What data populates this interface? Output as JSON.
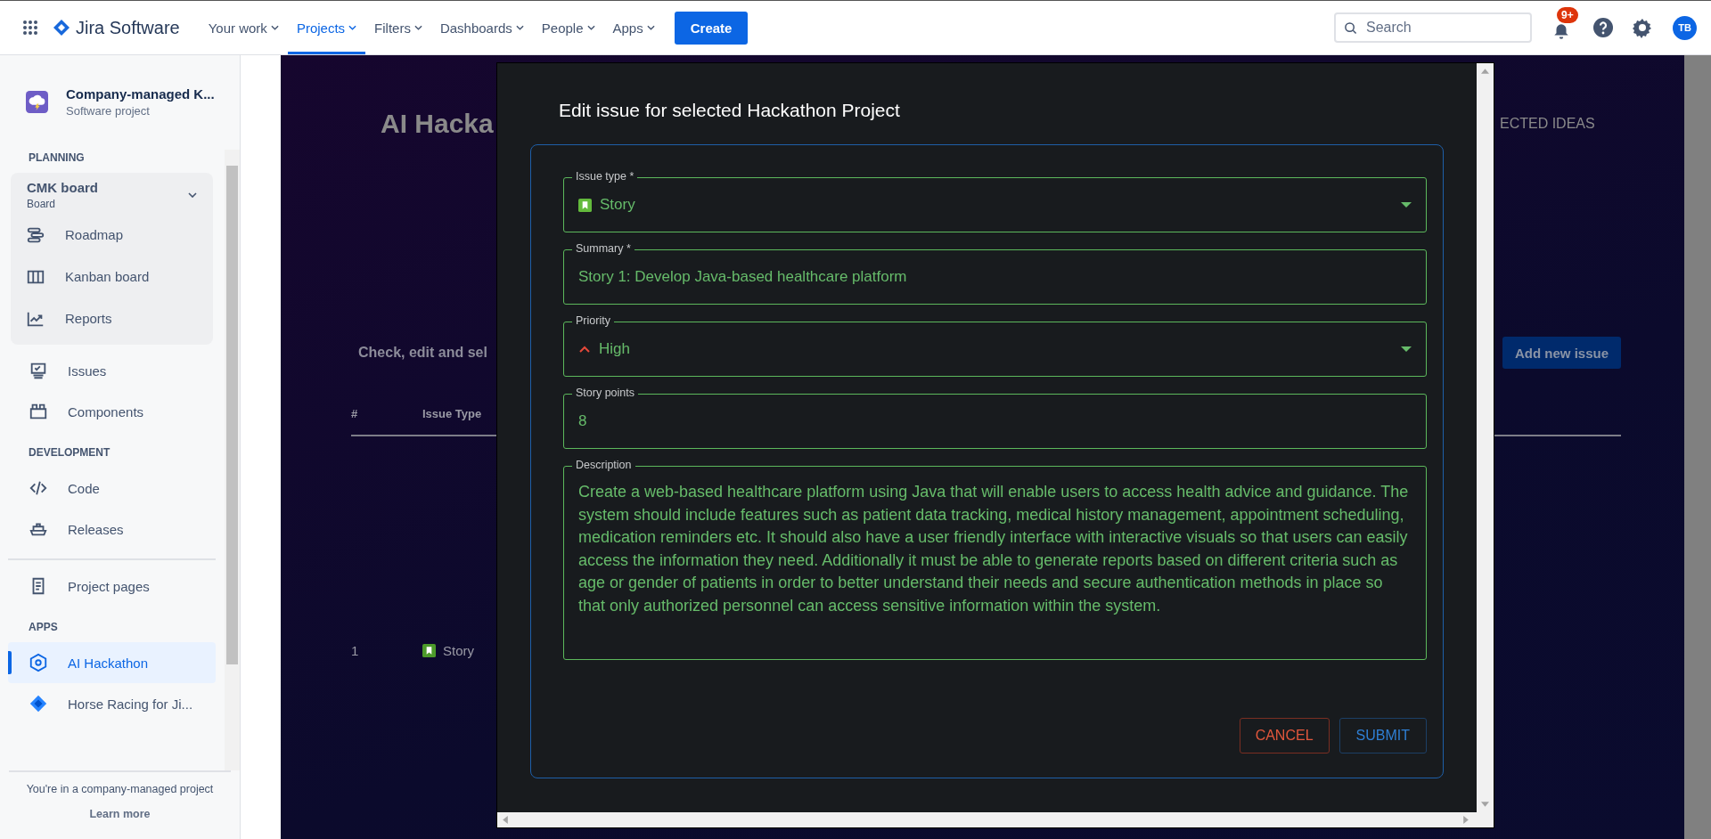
{
  "topbar": {
    "product": "Jira Software",
    "nav": [
      {
        "label": "Your work",
        "selected": false
      },
      {
        "label": "Projects",
        "selected": true
      },
      {
        "label": "Filters",
        "selected": false
      },
      {
        "label": "Dashboards",
        "selected": false
      },
      {
        "label": "People",
        "selected": false
      },
      {
        "label": "Apps",
        "selected": false
      }
    ],
    "create": "Create",
    "search": {
      "placeholder": "Search"
    },
    "notifications_badge": "9+",
    "avatar": "TB"
  },
  "sidebar": {
    "project_name": "Company-managed K...",
    "project_type": "Software project",
    "planning": {
      "heading": "PLANNING",
      "board": {
        "name": "CMK board",
        "subtitle": "Board",
        "expanded": true,
        "items": [
          {
            "label": "Roadmap",
            "selected": false
          },
          {
            "label": "Kanban board",
            "selected": false
          },
          {
            "label": "Reports",
            "selected": false
          }
        ]
      },
      "items": [
        {
          "label": "Issues",
          "selected": false
        },
        {
          "label": "Components",
          "selected": false
        }
      ]
    },
    "development": {
      "heading": "DEVELOPMENT",
      "items": [
        {
          "label": "Code",
          "selected": false
        },
        {
          "label": "Releases",
          "selected": false
        }
      ]
    },
    "project_pages": "Project pages",
    "apps": {
      "heading": "APPS",
      "items": [
        {
          "label": "AI Hackathon",
          "selected": true
        },
        {
          "label": "Horse Racing for Ji...",
          "selected": false
        }
      ]
    },
    "footer": {
      "text": "You're in a company-managed project",
      "link": "Learn more"
    }
  },
  "background": {
    "title": "AI Hacka",
    "tab": "ECTED IDEAS",
    "intro": "Check, edit and sel",
    "add_button": "Add new issue",
    "table": {
      "columns": [
        "#",
        "Issue Type"
      ],
      "rows": [
        {
          "cells": [
            "1",
            "Story"
          ]
        }
      ]
    }
  },
  "dialog": {
    "title": "Edit issue for selected Hackathon Project",
    "fields": [
      {
        "label": "Issue type *",
        "kind": "type-select",
        "value": "Story"
      },
      {
        "label": "Summary *",
        "kind": "text",
        "value": "Story 1: Develop Java-based healthcare platform"
      },
      {
        "label": "Priority",
        "kind": "priority-select",
        "value": "High"
      },
      {
        "label": "Story points",
        "kind": "text",
        "value": "8"
      },
      {
        "label": "Description",
        "kind": "textarea",
        "value": " Create a web-based healthcare platform using Java that will enable users to access health advice and guidance. The system should include features such as patient data tracking, medical history management, appointment scheduling, medication reminders etc. It should also have a user friendly interface with interactive visuals so that users can easily access the information they need. Additionally it must be able to generate reports based on different criteria such as age or gender of patients in order to better understand their needs and secure authentication methods in place so that only authorized personnel can access sensitive information within the system."
      }
    ],
    "cancel": "CANCEL",
    "submit": "SUBMIT"
  }
}
